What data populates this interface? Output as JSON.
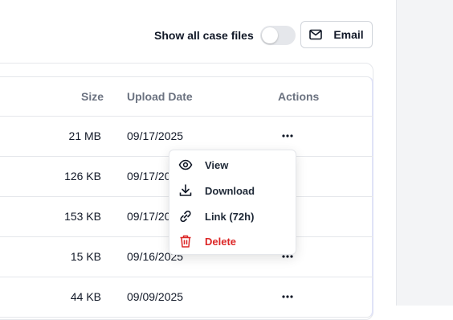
{
  "header": {
    "toggle_label": "Show all case files",
    "toggle_on": false,
    "email_label": "Email"
  },
  "table": {
    "columns": {
      "size": "Size",
      "upload_date": "Upload Date",
      "actions": "Actions"
    },
    "rows": [
      {
        "size": "21 MB",
        "date": "09/17/2025"
      },
      {
        "size": "126 KB",
        "date": "09/17/2025"
      },
      {
        "size": "153 KB",
        "date": "09/17/2025"
      },
      {
        "size": "15 KB",
        "date": "09/16/2025"
      },
      {
        "size": "44 KB",
        "date": "09/09/2025"
      }
    ]
  },
  "actions_menu": {
    "items": [
      {
        "label": "View",
        "icon": "eye-icon"
      },
      {
        "label": "Download",
        "icon": "download-icon"
      },
      {
        "label": "Link (72h)",
        "icon": "link-icon"
      },
      {
        "label": "Delete",
        "icon": "trash-icon"
      }
    ]
  },
  "colors": {
    "danger": "#dc2626",
    "muted": "#6b7280",
    "border": "#e5e7eb"
  }
}
